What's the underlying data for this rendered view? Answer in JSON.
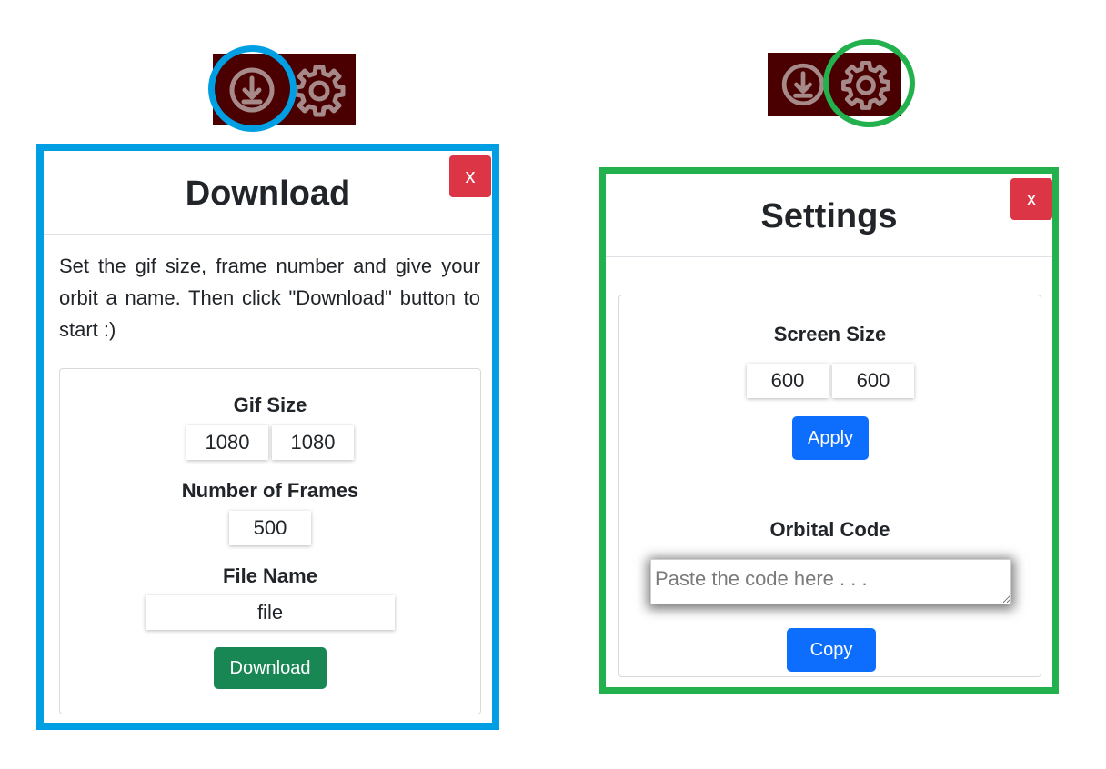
{
  "colors": {
    "toolbar_bg": "#4a0000",
    "icon_color": "#a68a8a",
    "download_highlight": "#009fe3",
    "settings_highlight": "#22b14c",
    "close_button": "#dc3545",
    "download_button": "#198754",
    "primary_button": "#0d6efd"
  },
  "icons": {
    "download": "download-circle-icon",
    "settings": "gear-icon"
  },
  "download_modal": {
    "title": "Download",
    "close_label": "x",
    "description": "Set the gif size, frame number and give your orbit a name. Then click \"Download\" button to start :)",
    "gif_size_label": "Gif Size",
    "gif_width": "1080",
    "gif_height": "1080",
    "frames_label": "Number of Frames",
    "frames_value": "500",
    "file_name_label": "File Name",
    "file_name_value": "file",
    "download_button": "Download"
  },
  "settings_modal": {
    "title": "Settings",
    "close_label": "x",
    "screen_size_label": "Screen Size",
    "screen_width": "600",
    "screen_height": "600",
    "apply_button": "Apply",
    "orbital_code_label": "Orbital Code",
    "orbital_code_placeholder": "Paste the code here . . .",
    "copy_button": "Copy"
  }
}
